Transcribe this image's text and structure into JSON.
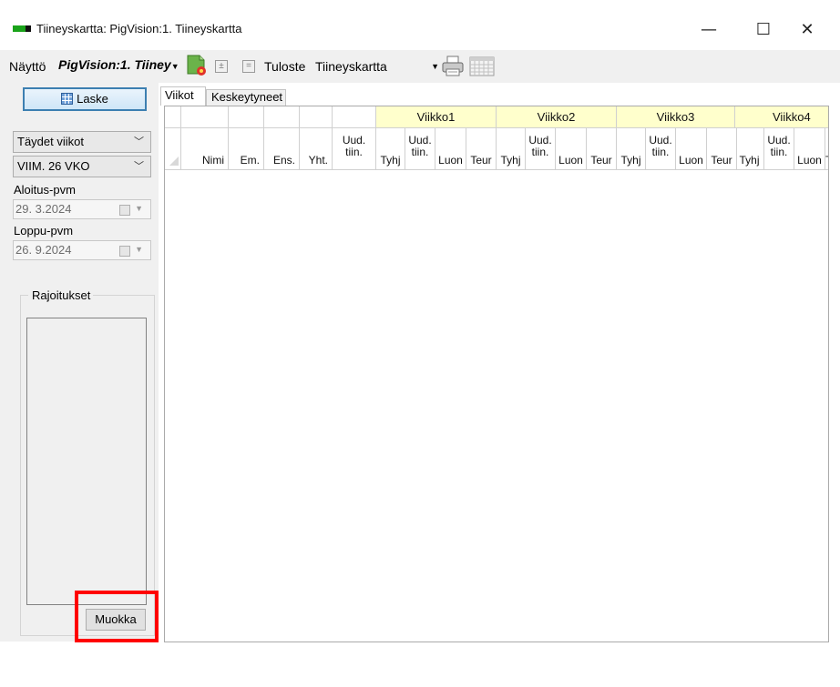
{
  "window": {
    "title": "Tiineyskartta: PigVision:1. Tiineyskartta",
    "minimize": "—",
    "maximize": "☐",
    "close": "✕"
  },
  "toolbar": {
    "view_label": "Näyttö",
    "view_value": "PigVision:1. Tiiney",
    "expand": "±",
    "collapse": "=",
    "print_label": "Tuloste",
    "print_value": "Tiineyskartta",
    "icons": [
      "settings-icon",
      "expand-icon",
      "collapse-icon",
      "printer-icon",
      "calendar-icon"
    ]
  },
  "left_panel": {
    "calc_button": "Laske",
    "weeks_dropdown": "Täydet viikot",
    "period_dropdown": "VIIM. 26 VKO",
    "start_date_label": "Aloitus-pvm",
    "start_date_value": "29.  3.2024",
    "end_date_label": "Loppu-pvm",
    "end_date_value": "26.  9.2024",
    "restrictions_label": "Rajoitukset",
    "edit_button": "Muokka"
  },
  "tabs": [
    {
      "label": "Viikot",
      "active": true
    },
    {
      "label": "Keskeytyneet",
      "active": false
    }
  ],
  "grid": {
    "fixed_columns": [
      "Nimi",
      "Em.",
      "Ens.",
      "Yht.",
      "Uud. tiin."
    ],
    "week_groups": [
      "Viikko1",
      "Viikko2",
      "Viikko3",
      "Viikko4"
    ],
    "week_sub_columns": [
      "Tyhj",
      "Uud. tiin.",
      "Luon",
      "Teur"
    ],
    "header_bg": "#ffffcc"
  },
  "colors": {
    "highlight": "#ff0000",
    "calc_button_border": "#3c7fb1",
    "panel_bg": "#f0f0f0"
  }
}
